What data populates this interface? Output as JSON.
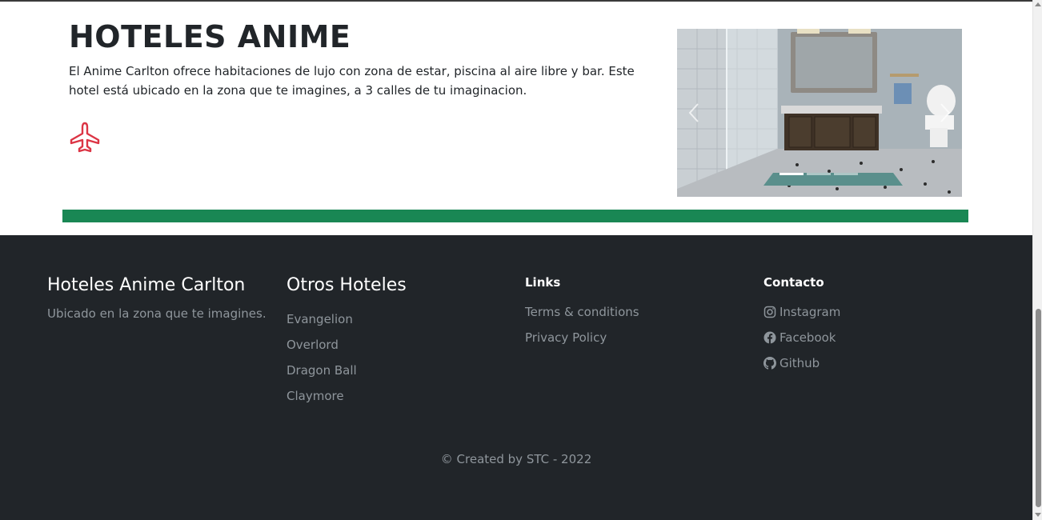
{
  "hotel": {
    "title": "HOTELES ANIME",
    "description": "El Anime Carlton ofrece habitaciones de lujo con zona de estar, piscina al aire libre y bar. Este hotel está ubicado en la zona que te imagines, a 3 calles de tu imaginacion.",
    "icon": "airplane-icon",
    "accent_color": "#dc3545"
  },
  "carousel": {
    "slide_count": 3,
    "active_index": 0,
    "prev_icon": "chevron-left-icon",
    "next_icon": "chevron-right-icon"
  },
  "divider_color": "#198754",
  "footer": {
    "background": "#212529",
    "brand": {
      "title": "Hoteles Anime Carlton",
      "subtitle": "Ubicado en la zona que te imagines."
    },
    "otros": {
      "title": "Otros Hoteles",
      "items": [
        "Evangelion",
        "Overlord",
        "Dragon Ball",
        "Claymore"
      ]
    },
    "links": {
      "title": "Links",
      "items": [
        "Terms & conditions",
        "Privacy Policy"
      ]
    },
    "contacto": {
      "title": "Contacto",
      "items": [
        {
          "label": "Instagram",
          "icon": "instagram-icon"
        },
        {
          "label": "Facebook",
          "icon": "facebook-icon"
        },
        {
          "label": "Github",
          "icon": "github-icon"
        }
      ]
    },
    "copyright": "© Created by STC - 2022"
  }
}
